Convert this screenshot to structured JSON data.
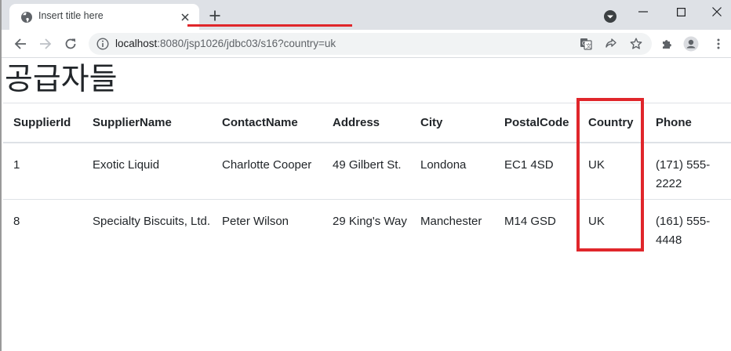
{
  "tab": {
    "title": "Insert title here"
  },
  "address_bar": {
    "host": "localhost",
    "path": ":8080/jsp1026/jdbc03/s16?country=uk"
  },
  "page": {
    "title": "공급자들"
  },
  "table": {
    "headers": [
      "SupplierId",
      "SupplierName",
      "ContactName",
      "Address",
      "City",
      "PostalCode",
      "Country",
      "Phone"
    ],
    "rows": [
      [
        "1",
        "Exotic Liquid",
        "Charlotte Cooper",
        "49 Gilbert St.",
        "Londona",
        "EC1 4SD",
        "UK",
        "(171) 555-2222"
      ],
      [
        "8",
        "Specialty Biscuits, Ltd.",
        "Peter Wilson",
        "29 King's Way",
        "Manchester",
        "M14 GSD",
        "UK",
        "(161) 555-4448"
      ]
    ]
  },
  "annotations": {
    "color": "#e0262b",
    "highlighted_column": "Country"
  },
  "icons": {
    "tab_favicon": "globe-icon",
    "tab_close": "close-icon",
    "new_tab": "plus-icon",
    "tab_search": "chevron-down-circle-icon",
    "minimize": "minimize-icon",
    "maximize": "maximize-icon",
    "close_window": "close-icon",
    "back": "arrow-left-icon",
    "forward": "arrow-right-icon",
    "reload": "reload-icon",
    "site_info": "info-icon",
    "translate": "translate-icon",
    "share": "share-icon",
    "bookmark": "star-icon",
    "extensions": "puzzle-icon",
    "profile": "person-icon",
    "menu": "kebab-menu-icon"
  }
}
